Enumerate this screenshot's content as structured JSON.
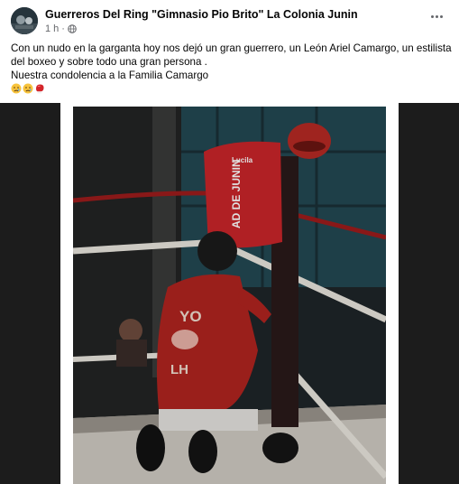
{
  "post": {
    "page_name": "Guerreros Del Ring \"Gimnasio Pio Brito\" La Colonia Junin",
    "time": "1 h",
    "privacy_icon": "globe-icon",
    "more_icon": "more-options-icon",
    "text_lines": [
      "Con un nudo en la garganta hoy nos dejó un gran guerrero, un León Ariel Camargo, un estilista",
      "del boxeo y sobre todo una gran persona .",
      "Nuestra condolencia  a la Familia Camargo"
    ],
    "emojis": [
      "sad-face-emoji",
      "sad-face-emoji",
      "boxing-glove-emoji"
    ]
  },
  "photo": {
    "corner_pad_text": "AD DE JUNIN",
    "corner_pad_logo": "Lucila",
    "shirt_text_top": "YO",
    "shirt_text_bottom": "LH"
  }
}
